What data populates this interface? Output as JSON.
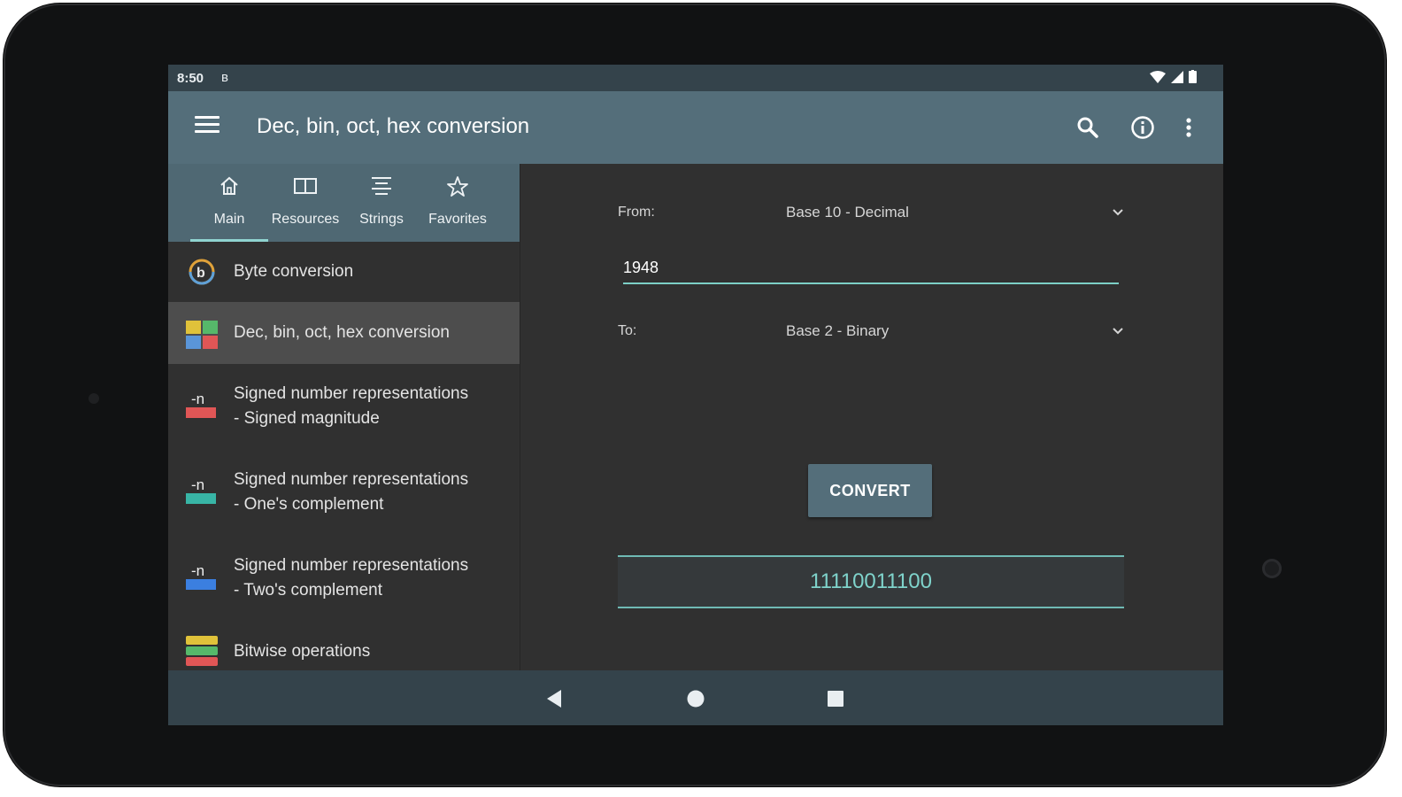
{
  "status": {
    "time": "8:50",
    "bt_glyph": "ʙ"
  },
  "appbar": {
    "title": "Dec, bin, oct, hex conversion",
    "icons": [
      "menu-icon",
      "search-icon",
      "info-icon",
      "more-vert-icon"
    ]
  },
  "tabs": [
    {
      "label": "Main",
      "icon": "home-icon",
      "active": true
    },
    {
      "label": "Resources",
      "icon": "book-icon"
    },
    {
      "label": "Strings",
      "icon": "strings-icon"
    },
    {
      "label": "Favorites",
      "icon": "star-icon"
    }
  ],
  "list": [
    {
      "label_lines": [
        "Byte conversion"
      ],
      "icon": "byte-icon"
    },
    {
      "label_lines": [
        "Dec, bin, oct, hex conversion"
      ],
      "icon": "base-grid-icon",
      "selected": true
    },
    {
      "label_lines": [
        "Signed number representations",
        "- Signed magnitude"
      ],
      "icon": "signed-magnitude-icon",
      "badge": "-n",
      "badge_color": "#e05656"
    },
    {
      "label_lines": [
        "Signed number representations",
        "- One's complement"
      ],
      "icon": "ones-complement-icon",
      "badge": "-n",
      "badge_color": "#38b5a6"
    },
    {
      "label_lines": [
        "Signed number representations",
        "- Two's complement"
      ],
      "icon": "twos-complement-icon",
      "badge": "-n",
      "badge_color": "#3b7fe0"
    },
    {
      "label_lines": [
        "Bitwise operations"
      ],
      "icon": "bitwise-icon"
    }
  ],
  "form": {
    "from_label": "From:",
    "from_value": "Base 10 - Decimal",
    "input_value": "1948",
    "to_label": "To:",
    "to_value": "Base 2 - Binary",
    "convert_label": "CONVERT",
    "result": "11110011100"
  },
  "colors": {
    "appbar": "#546e7a",
    "accent": "#7fd3cb",
    "status": "#34434b"
  }
}
